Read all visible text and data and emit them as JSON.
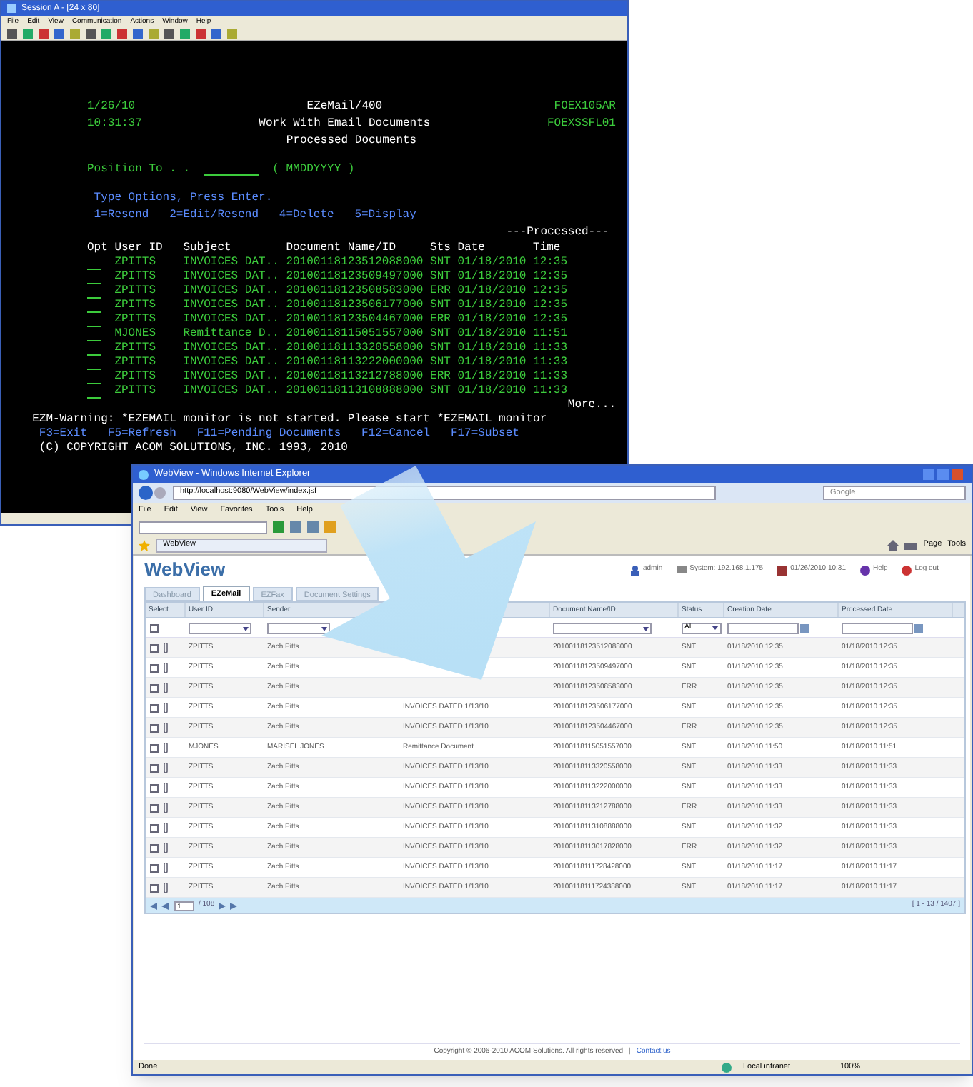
{
  "terminal": {
    "title": "Session A - [24 x 80]",
    "menu": [
      "File",
      "Edit",
      "View",
      "Communication",
      "Actions",
      "Window",
      "Help"
    ],
    "screen": {
      "date": "1/26/10",
      "time": "10:31:37",
      "app": "EZeMail/400",
      "title": "Work With Email Documents",
      "subtitle": "Processed Documents",
      "program": "FOEX105AR",
      "format": "FOEXSSFL01",
      "position_label": "Position To . .",
      "position_hint": "( MMDDYYYY )",
      "instructions": "Type Options, Press Enter.",
      "options": [
        "1=Resend",
        "2=Edit/Resend",
        "4=Delete",
        "5=Display"
      ],
      "group_heading": "---Processed---",
      "columns": [
        "Opt",
        "User ID",
        "Subject",
        "Document Name/ID",
        "Sts",
        "Date",
        "Time"
      ],
      "rows": [
        {
          "user": "ZPITTS",
          "subject": "INVOICES DAT..",
          "document": "20100118123512088000",
          "status": "SNT",
          "date": "01/18/2010",
          "time": "12:35"
        },
        {
          "user": "ZPITTS",
          "subject": "INVOICES DAT..",
          "document": "20100118123509497000",
          "status": "SNT",
          "date": "01/18/2010",
          "time": "12:35"
        },
        {
          "user": "ZPITTS",
          "subject": "INVOICES DAT..",
          "document": "20100118123508583000",
          "status": "ERR",
          "date": "01/18/2010",
          "time": "12:35"
        },
        {
          "user": "ZPITTS",
          "subject": "INVOICES DAT..",
          "document": "20100118123506177000",
          "status": "SNT",
          "date": "01/18/2010",
          "time": "12:35"
        },
        {
          "user": "ZPITTS",
          "subject": "INVOICES DAT..",
          "document": "20100118123504467000",
          "status": "ERR",
          "date": "01/18/2010",
          "time": "12:35"
        },
        {
          "user": "MJONES",
          "subject": "Remittance D..",
          "document": "20100118115051557000",
          "status": "SNT",
          "date": "01/18/2010",
          "time": "11:51"
        },
        {
          "user": "ZPITTS",
          "subject": "INVOICES DAT..",
          "document": "20100118113320558000",
          "status": "SNT",
          "date": "01/18/2010",
          "time": "11:33"
        },
        {
          "user": "ZPITTS",
          "subject": "INVOICES DAT..",
          "document": "20100118113222000000",
          "status": "SNT",
          "date": "01/18/2010",
          "time": "11:33"
        },
        {
          "user": "ZPITTS",
          "subject": "INVOICES DAT..",
          "document": "20100118113212788000",
          "status": "ERR",
          "date": "01/18/2010",
          "time": "11:33"
        },
        {
          "user": "ZPITTS",
          "subject": "INVOICES DAT..",
          "document": "20100118113108888000",
          "status": "SNT",
          "date": "01/18/2010",
          "time": "11:33"
        }
      ],
      "more": "More...",
      "warning": "EZM-Warning: *EZEMAIL monitor is not started. Please start *EZEMAIL monitor",
      "function_keys": [
        "F3=Exit",
        "F5=Refresh",
        "F11=Pending Documents",
        "F12=Cancel",
        "F17=Subset"
      ],
      "copyright": "(C) COPYRIGHT ACOM SOLUTIONS, INC. 1993, 2010"
    }
  },
  "browser": {
    "title": "WebView - Windows Internet Explorer",
    "url": "http://localhost:9080/WebView/index.jsf",
    "search_placeholder": "Google",
    "menu": [
      "File",
      "Edit",
      "View",
      "Favorites",
      "Tools",
      "Help"
    ],
    "favorite_tab": "WebView",
    "command_bar": [
      "Page",
      "Tools"
    ],
    "status": "Done",
    "zone": "Local intranet",
    "zoom": "100%"
  },
  "page": {
    "logo": "WebView",
    "user": "admin",
    "system": "System: 192.168.1.175",
    "datetime": "01/26/2010 10:31",
    "help": "Help",
    "logout": "Log out",
    "tabs": [
      {
        "label": "Dashboard",
        "selected": false
      },
      {
        "label": "EZeMail",
        "selected": true
      },
      {
        "label": "EZFax",
        "selected": false
      },
      {
        "label": "Document Settings",
        "selected": false
      }
    ],
    "header": {
      "select": "Select",
      "user_id": "User ID",
      "sender": "Sender",
      "document_name": "Document Name/ID",
      "status": "Status",
      "creation_date": "Creation Date",
      "processed_date": "Processed Date"
    },
    "select_all": {
      "checked": false
    },
    "status_filter": "ALL",
    "rows": [
      {
        "checked": false,
        "user_id": "ZPITTS",
        "sender": "Zach Pitts",
        "document_name": "20100118123512088000",
        "status": "SNT",
        "creation_date": "01/18/2010 12:35",
        "processed_date": "01/18/2010 12:35"
      },
      {
        "checked": false,
        "user_id": "ZPITTS",
        "sender": "Zach Pitts",
        "document_name": "20100118123509497000",
        "status": "SNT",
        "creation_date": "01/18/2010 12:35",
        "processed_date": "01/18/2010 12:35"
      },
      {
        "checked": false,
        "user_id": "ZPITTS",
        "sender": "Zach Pitts",
        "document_name": "20100118123508583000",
        "status": "ERR",
        "creation_date": "01/18/2010 12:35",
        "processed_date": "01/18/2010 12:35"
      },
      {
        "checked": false,
        "user_id": "ZPITTS",
        "sender": "Zach Pitts",
        "subject": "INVOICES DATED 1/13/10",
        "document_name": "20100118123506177000",
        "status": "SNT",
        "creation_date": "01/18/2010 12:35",
        "processed_date": "01/18/2010 12:35"
      },
      {
        "checked": false,
        "user_id": "ZPITTS",
        "sender": "Zach Pitts",
        "subject": "INVOICES DATED 1/13/10",
        "document_name": "20100118123504467000",
        "status": "ERR",
        "creation_date": "01/18/2010 12:35",
        "processed_date": "01/18/2010 12:35"
      },
      {
        "checked": false,
        "user_id": "MJONES",
        "sender": "MARISEL JONES",
        "subject": "Remittance Document",
        "document_name": "20100118115051557000",
        "status": "SNT",
        "creation_date": "01/18/2010 11:50",
        "processed_date": "01/18/2010 11:51"
      },
      {
        "checked": false,
        "user_id": "ZPITTS",
        "sender": "Zach Pitts",
        "subject": "INVOICES DATED 1/13/10",
        "document_name": "20100118113320558000",
        "status": "SNT",
        "creation_date": "01/18/2010 11:33",
        "processed_date": "01/18/2010 11:33"
      },
      {
        "checked": false,
        "user_id": "ZPITTS",
        "sender": "Zach Pitts",
        "subject": "INVOICES DATED 1/13/10",
        "document_name": "20100118113222000000",
        "status": "SNT",
        "creation_date": "01/18/2010 11:33",
        "processed_date": "01/18/2010 11:33"
      },
      {
        "checked": false,
        "user_id": "ZPITTS",
        "sender": "Zach Pitts",
        "subject": "INVOICES DATED 1/13/10",
        "document_name": "20100118113212788000",
        "status": "ERR",
        "creation_date": "01/18/2010 11:33",
        "processed_date": "01/18/2010 11:33"
      },
      {
        "checked": false,
        "user_id": "ZPITTS",
        "sender": "Zach Pitts",
        "subject": "INVOICES DATED 1/13/10",
        "document_name": "20100118113108888000",
        "status": "SNT",
        "creation_date": "01/18/2010 11:32",
        "processed_date": "01/18/2010 11:33"
      },
      {
        "checked": false,
        "user_id": "ZPITTS",
        "sender": "Zach Pitts",
        "subject": "INVOICES DATED 1/13/10",
        "document_name": "20100118113017828000",
        "status": "ERR",
        "creation_date": "01/18/2010 11:32",
        "processed_date": "01/18/2010 11:33"
      },
      {
        "checked": false,
        "user_id": "ZPITTS",
        "sender": "Zach Pitts",
        "subject": "INVOICES DATED 1/13/10",
        "document_name": "20100118111728428000",
        "status": "SNT",
        "creation_date": "01/18/2010 11:17",
        "processed_date": "01/18/2010 11:17"
      },
      {
        "checked": false,
        "user_id": "ZPITTS",
        "sender": "Zach Pitts",
        "subject": "INVOICES DATED 1/13/10",
        "document_name": "20100118111724388000",
        "status": "SNT",
        "creation_date": "01/18/2010 11:17",
        "processed_date": "01/18/2010 11:17"
      }
    ],
    "pager": {
      "page": "1",
      "total": "/ 108",
      "range": "[ 1 - 13 / 1407 ]"
    },
    "footer": "Copyright © 2006-2010 ACOM Solutions. All rights reserved",
    "separator": "|",
    "contact": "Contact us"
  }
}
